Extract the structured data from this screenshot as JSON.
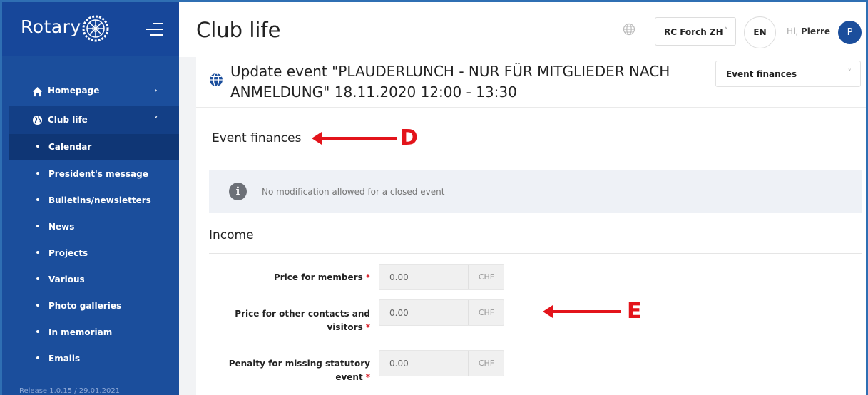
{
  "sidebar": {
    "logo_text": "Rotary",
    "items": [
      {
        "label": "Homepage",
        "chevron": "›"
      },
      {
        "label": "Club life",
        "chevron": "˅"
      }
    ],
    "sub_items": [
      "Calendar",
      "President's message",
      "Bulletins/newsletters",
      "News",
      "Projects",
      "Various",
      "Photo galleries",
      "In memoriam",
      "Emails"
    ],
    "release": "Release 1.0.15 / 29.01.2021"
  },
  "header": {
    "title": "Club life",
    "club": "RC Forch ZH",
    "language": "EN",
    "greeting": "Hi,",
    "user": "Pierre",
    "avatar_initial": "P"
  },
  "event": {
    "title": "Update event \"PLAUDERLUNCH - NUR FÜR MITGLIEDER NACH ANMELDUNG\" 18.11.2020 12:00 - 13:30",
    "section_dropdown": "Event finances",
    "section_title": "Event finances",
    "info_icon": "i",
    "info_message": "No modification allowed for a closed event",
    "income_heading": "Income"
  },
  "fields": [
    {
      "label_line1": "Price for members",
      "label_line2": "",
      "value": "0.00",
      "unit": "CHF",
      "required": "*"
    },
    {
      "label_line1": "Price for other contacts and",
      "label_line2": "visitors",
      "value": "0.00",
      "unit": "CHF",
      "required": "*"
    },
    {
      "label_line1": "Penalty for missing statutory",
      "label_line2": "event",
      "value": "0.00",
      "unit": "CHF",
      "required": "*"
    }
  ],
  "annotations": {
    "d": "D",
    "e": "E"
  },
  "colors": {
    "sidebar": "#1b4e9c",
    "accent": "#e3141b",
    "required": "#d9232d"
  }
}
